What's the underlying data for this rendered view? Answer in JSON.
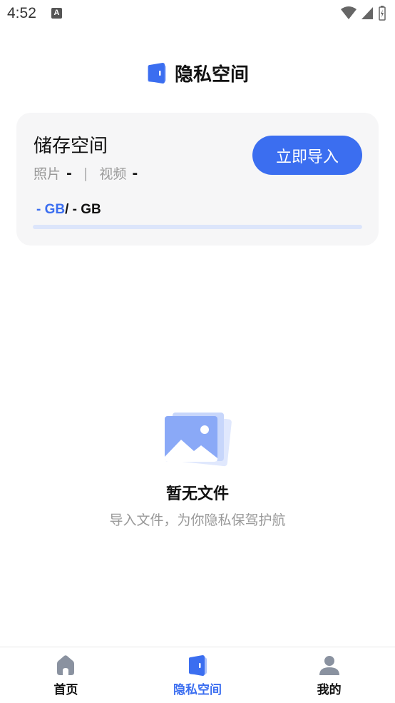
{
  "status_bar": {
    "time": "4:52",
    "notification_badge": "A"
  },
  "header": {
    "title": "隐私空间",
    "icon": "private-space-icon"
  },
  "storage": {
    "title": "储存空间",
    "photos_label": "照片",
    "photos_value": "-",
    "divider": "|",
    "videos_label": "视频",
    "videos_value": "-",
    "import_button": "立即导入",
    "used": "- GB",
    "total": "/ - GB",
    "progress": 0
  },
  "empty_state": {
    "icon": "image-placeholder-icon",
    "title": "暂无文件",
    "subtitle": "导入文件，为你隐私保驾护航"
  },
  "tab_bar": {
    "items": [
      {
        "label": "首页",
        "icon": "home-icon",
        "active": false
      },
      {
        "label": "隐私空间",
        "icon": "private-space-icon",
        "active": true
      },
      {
        "label": "我的",
        "icon": "user-icon",
        "active": false
      }
    ]
  },
  "colors": {
    "accent": "#3b6ef0",
    "inactive_icon": "#8a92a0",
    "card_bg": "#f6f6f7",
    "muted_text": "#999999"
  }
}
